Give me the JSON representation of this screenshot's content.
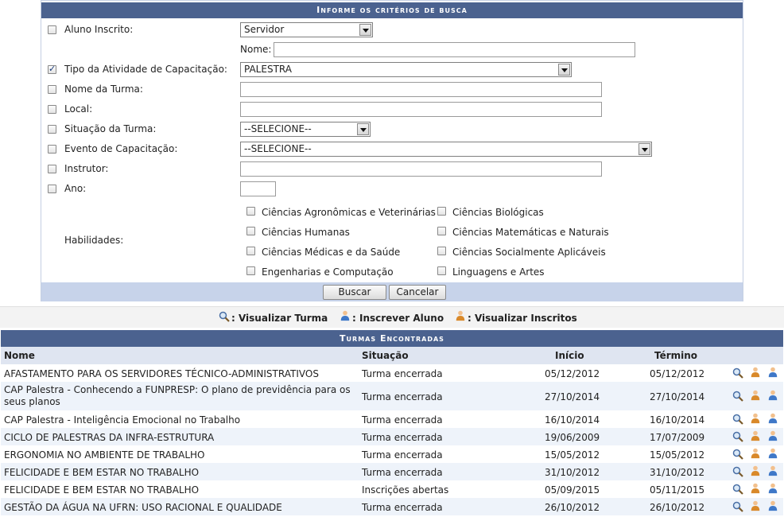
{
  "form": {
    "title": "Informe os critérios de busca",
    "aluno_inscrito": {
      "label": "Aluno Inscrito:",
      "select_value": "Servidor",
      "nome_label": "Nome:"
    },
    "tipo_atividade": {
      "label": "Tipo da Atividade de Capacitação:",
      "value": "PALESTRA",
      "checked": true
    },
    "nome_turma": {
      "label": "Nome da Turma:"
    },
    "local": {
      "label": "Local:"
    },
    "situacao_turma": {
      "label": "Situação da Turma:",
      "value": "--SELECIONE--"
    },
    "evento": {
      "label": "Evento de Capacitação:",
      "value": "--SELECIONE--"
    },
    "instrutor": {
      "label": "Instrutor:"
    },
    "ano": {
      "label": "Ano:"
    },
    "habilidades": {
      "label": "Habilidades:",
      "items": [
        "Ciências Agronômicas e Veterinárias",
        "Ciências Biológicas",
        "Ciências Humanas",
        "Ciências Matemáticas e Naturais",
        "Ciências Médicas e da Saúde",
        "Ciências Socialmente Aplicáveis",
        "Engenharias e Computação",
        "Linguagens e Artes"
      ]
    },
    "buttons": {
      "buscar": "Buscar",
      "cancelar": "Cancelar"
    }
  },
  "legend": {
    "visualizar_turma": ": Visualizar Turma",
    "inscrever_aluno": ": Inscrever Aluno",
    "visualizar_inscritos": ": Visualizar Inscritos"
  },
  "results": {
    "title": "Turmas Encontradas",
    "columns": [
      "Nome",
      "Situação",
      "Início",
      "Término"
    ],
    "rows": [
      {
        "nome": "AFASTAMENTO PARA OS SERVIDORES TÉCNICO-ADMINISTRATIVOS",
        "situacao": "Turma encerrada",
        "inicio": "05/12/2012",
        "termino": "05/12/2012"
      },
      {
        "nome": "CAP Palestra - Conhecendo a FUNPRESP: O plano de previdência para os seus planos",
        "situacao": "Turma encerrada",
        "inicio": "27/10/2014",
        "termino": "27/10/2014"
      },
      {
        "nome": "CAP Palestra - Inteligência Emocional no Trabalho",
        "situacao": "Turma encerrada",
        "inicio": "16/10/2014",
        "termino": "16/10/2014"
      },
      {
        "nome": "CICLO DE PALESTRAS DA INFRA-ESTRUTURA",
        "situacao": "Turma encerrada",
        "inicio": "19/06/2009",
        "termino": "17/07/2009"
      },
      {
        "nome": "ERGONOMIA NO AMBIENTE DE TRABALHO",
        "situacao": "Turma encerrada",
        "inicio": "15/05/2012",
        "termino": "15/05/2012"
      },
      {
        "nome": "FELICIDADE E BEM ESTAR NO TRABALHO",
        "situacao": "Turma encerrada",
        "inicio": "31/10/2012",
        "termino": "31/10/2012"
      },
      {
        "nome": "FELICIDADE E BEM ESTAR NO TRABALHO",
        "situacao": "Inscrições abertas",
        "inicio": "05/09/2015",
        "termino": "05/11/2015"
      },
      {
        "nome": "GESTÃO DA ÁGUA NA UFRN: USO RACIONAL E QUALIDADE",
        "situacao": "Turma encerrada",
        "inicio": "26/10/2012",
        "termino": "26/10/2012"
      }
    ]
  },
  "icons": {
    "magnifier": "magnifier-icon",
    "user_add": "user-add-icon",
    "user_view": "user-view-icon"
  },
  "colors": {
    "caption_bg": "#4b628f",
    "header_bg": "#dfe5f1",
    "footer_bg": "#c7d3ea",
    "row_alt": "#eef3fa"
  }
}
